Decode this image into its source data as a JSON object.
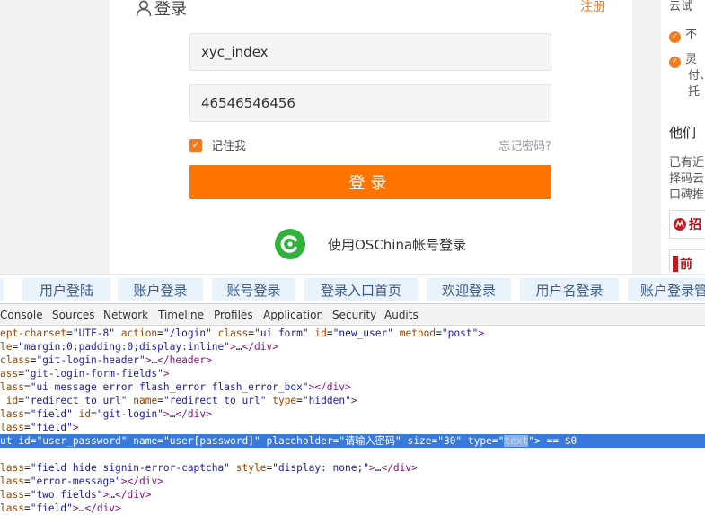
{
  "login": {
    "title": "登录",
    "register_link": "注册",
    "username_value": "xyc_index",
    "password_value": "46546546456",
    "remember_label": "记住我",
    "forgot_link": "忘记密码?",
    "submit_label": "登录",
    "oschina_label": "使用OSChina帐号登录"
  },
  "right_panel": {
    "top_text": "云试",
    "item1": "不",
    "item2_line1": "灵",
    "item2_line2": "付、",
    "item2_line3": "托",
    "heading": "他们",
    "para_line1": "已有近",
    "para_line2": "择码云",
    "para_line3": "口碑推",
    "logo1_text": "招",
    "logo2_text": "前"
  },
  "keywords": [
    "用户登陆",
    "账户登录",
    "账号登录",
    "登录入口首页",
    "欢迎登录",
    "用户名登录",
    "账户登录管"
  ],
  "devtools": {
    "tabs": [
      "Console",
      "Sources",
      "Network",
      "Timeline",
      "Profiles",
      "Application",
      "Security",
      "Audits"
    ],
    "lines": [
      "ept-charset=\"UTF-8\" action=\"/login\" class=\"ui form\" id=\"new_user\" method=\"post\">",
      "le=\"margin:0;padding:0;display:inline\">…</div>",
      "class=\"git-login-header\">…</header>",
      "ass=\"git-login-form-fields\">",
      "lass=\"ui message error flash_error flash_error_box\"></div>",
      " id=\"redirect_to_url\" name=\"redirect_to_url\" type=\"hidden\">",
      "lass=\"field\" id=\"git-login\">…</div>",
      "lass=\"field\">",
      "ut id=\"user_password\" name=\"user[password]\" placeholder=\"请输入密码\" size=\"30\" type=\"text\"> == $0",
      "",
      "lass=\"field hide signin-error-captcha\" style=\"display: none;\">…</div>",
      "lass=\"error-message\"></div>",
      "lass=\"two fields\">…</div>",
      "lass=\"field\">…</div>"
    ],
    "selected_line_index": 8
  },
  "colors": {
    "accent": "#ff7400",
    "oschina_green": "#2fb13c",
    "selection_blue": "#3879d9"
  }
}
